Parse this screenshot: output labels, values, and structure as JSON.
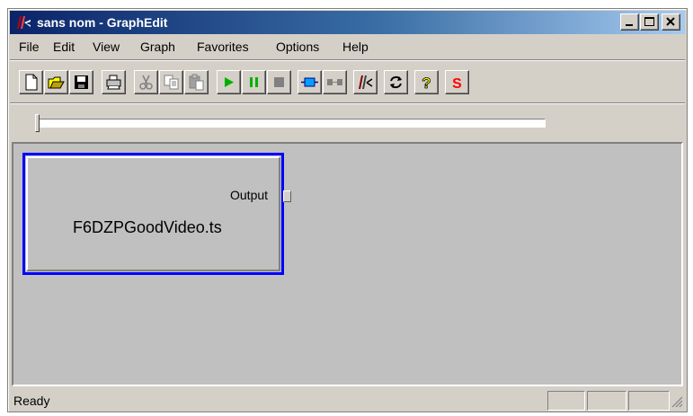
{
  "window": {
    "title": "sans nom - GraphEdit",
    "controls": {
      "minimize": "_",
      "maximize": "□",
      "close": "×"
    }
  },
  "menu": {
    "items": [
      "File",
      "Edit",
      "View",
      "Graph",
      "Favorites",
      "Options",
      "Help"
    ]
  },
  "toolbar": {
    "buttons": [
      {
        "icon": "new-document-icon",
        "enabled": true
      },
      {
        "icon": "open-folder-icon",
        "enabled": true
      },
      {
        "icon": "save-disk-icon",
        "enabled": true
      },
      {
        "icon": "print-icon",
        "enabled": true
      },
      {
        "icon": "cut-icon",
        "enabled": false
      },
      {
        "icon": "copy-icon",
        "enabled": false
      },
      {
        "icon": "paste-icon",
        "enabled": false
      },
      {
        "icon": "play-icon",
        "enabled": true
      },
      {
        "icon": "pause-icon",
        "enabled": true
      },
      {
        "icon": "stop-icon",
        "enabled": false
      },
      {
        "icon": "insert-filter-icon",
        "enabled": true
      },
      {
        "icon": "connect-pins-icon",
        "enabled": false
      },
      {
        "icon": "graphedit-filters-icon",
        "enabled": true
      },
      {
        "icon": "refresh-icon",
        "enabled": true
      },
      {
        "icon": "help-icon",
        "enabled": true
      },
      {
        "icon": "s-icon",
        "enabled": true
      }
    ],
    "colors": {
      "play": "#00b000",
      "pause": "#00b000",
      "insert": "#00a0ff",
      "s": "#ff0000",
      "help": "#ffff00"
    }
  },
  "seek": {
    "position": 0.0
  },
  "graph": {
    "filters": [
      {
        "name": "F6DZPGoodVideo.ts",
        "selected": true,
        "output_pin": "Output"
      }
    ],
    "selection_color": "#0000ff"
  },
  "status": {
    "text": "Ready"
  }
}
